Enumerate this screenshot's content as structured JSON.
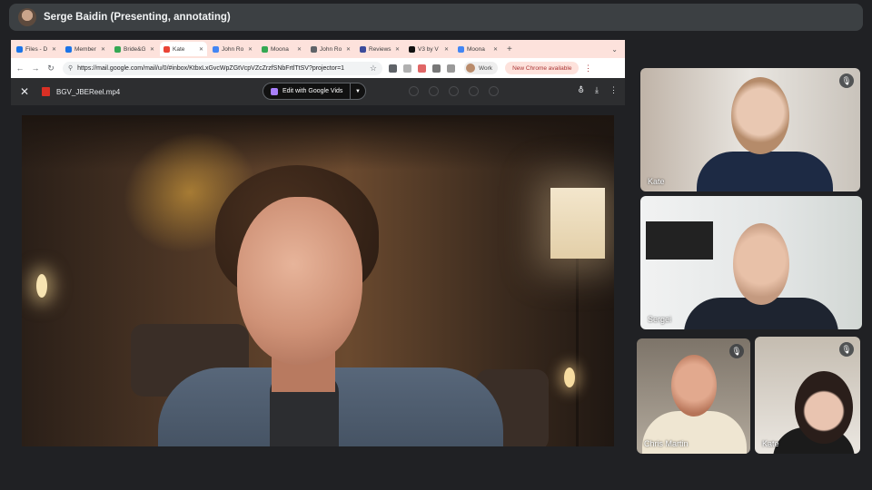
{
  "meet": {
    "presenter_label": "Serge Baidin (Presenting, annotating)"
  },
  "browser": {
    "tabs": [
      {
        "label": "Files - D",
        "color": "#1a73e8"
      },
      {
        "label": "Member",
        "color": "#1a73e8"
      },
      {
        "label": "Bride&G",
        "color": "#34a853"
      },
      {
        "label": "Kate",
        "color": "#ea4335",
        "active": true
      },
      {
        "label": "John Ro",
        "color": "#4285f4"
      },
      {
        "label": "Moona",
        "color": "#34a853"
      },
      {
        "label": "John Ro",
        "color": "#5f6368"
      },
      {
        "label": "Reviews",
        "color": "#3c4b9b"
      },
      {
        "label": "V3 by V",
        "color": "#111111"
      },
      {
        "label": "Moona",
        "color": "#4285f4"
      }
    ],
    "url": "https://mail.google.com/mail/u/0/#inbox/KtbxLxGvcWpZGtVcpVZcZrzfSNbFrtlTtSV?projector=1",
    "profile_label": "Work",
    "update_label": "New Chrome available"
  },
  "viewer": {
    "file_name": "BGV_JBEReel.mp4",
    "edit_button_label": "Edit with Google Vids"
  },
  "participants": [
    {
      "name": "Kate",
      "muted": true
    },
    {
      "name": "Sergei",
      "muted": false
    },
    {
      "name": "Chris Martin",
      "muted": true
    },
    {
      "name": "Kate",
      "muted": true
    }
  ]
}
